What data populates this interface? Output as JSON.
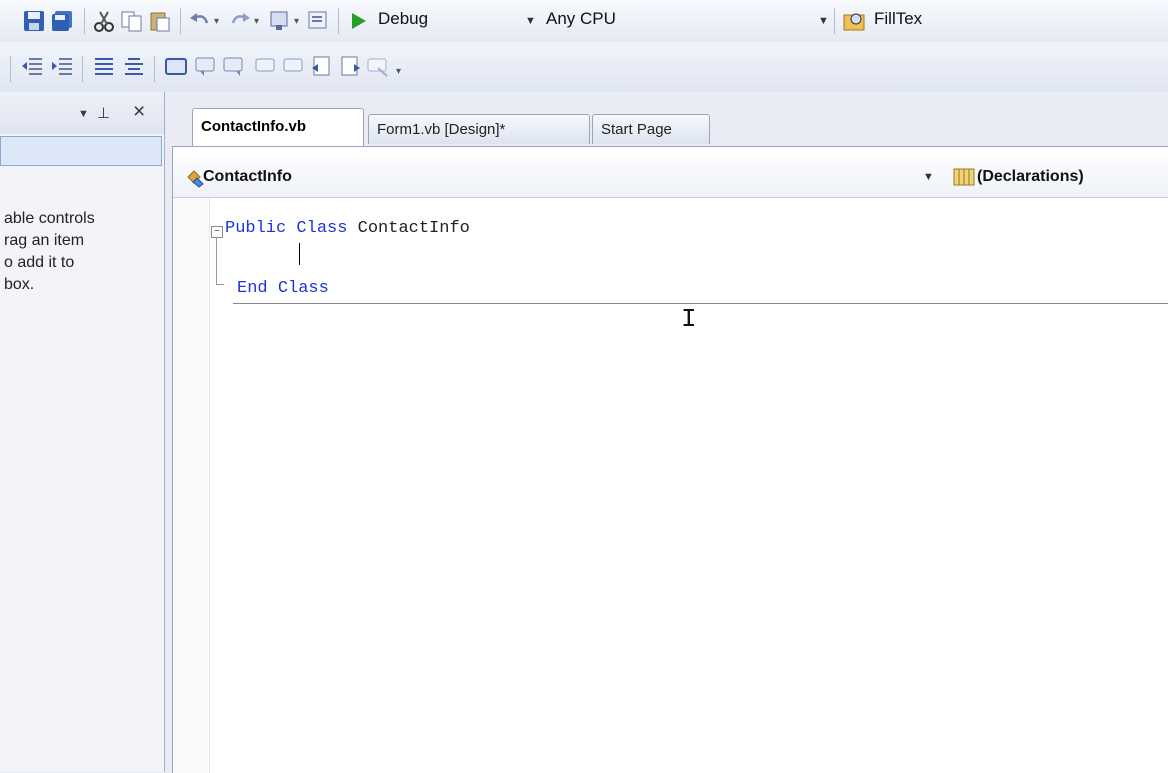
{
  "toolbar": {
    "config_value": "Debug",
    "platform_value": "Any CPU",
    "find_value": "FillTex",
    "icons": [
      "save-icon",
      "save-all-icon",
      "cut-icon",
      "copy-icon",
      "paste-icon",
      "undo-icon",
      "redo-icon",
      "navigate-icon",
      "find-icon",
      "start-debug-icon"
    ]
  },
  "toolbox": {
    "lines": [
      "able controls",
      "rag an item",
      "o add it to",
      "box."
    ]
  },
  "tabs": [
    {
      "label": "ContactInfo.vb",
      "active": true
    },
    {
      "label": "Form1.vb [Design]*",
      "active": false
    },
    {
      "label": "Start Page",
      "active": false
    }
  ],
  "editor": {
    "class_combo": "ContactInfo",
    "member_combo": "(Declarations)",
    "code": {
      "line1_kw1": "Public",
      "line1_kw2": "Class",
      "line1_name": "ContactInfo",
      "line3_kw1": "End",
      "line3_kw2": "Class"
    }
  },
  "colors": {
    "keyword": "#1d34d6",
    "toolbar_bg": "#e4e9f4",
    "editor_bg": "#ffffff"
  }
}
